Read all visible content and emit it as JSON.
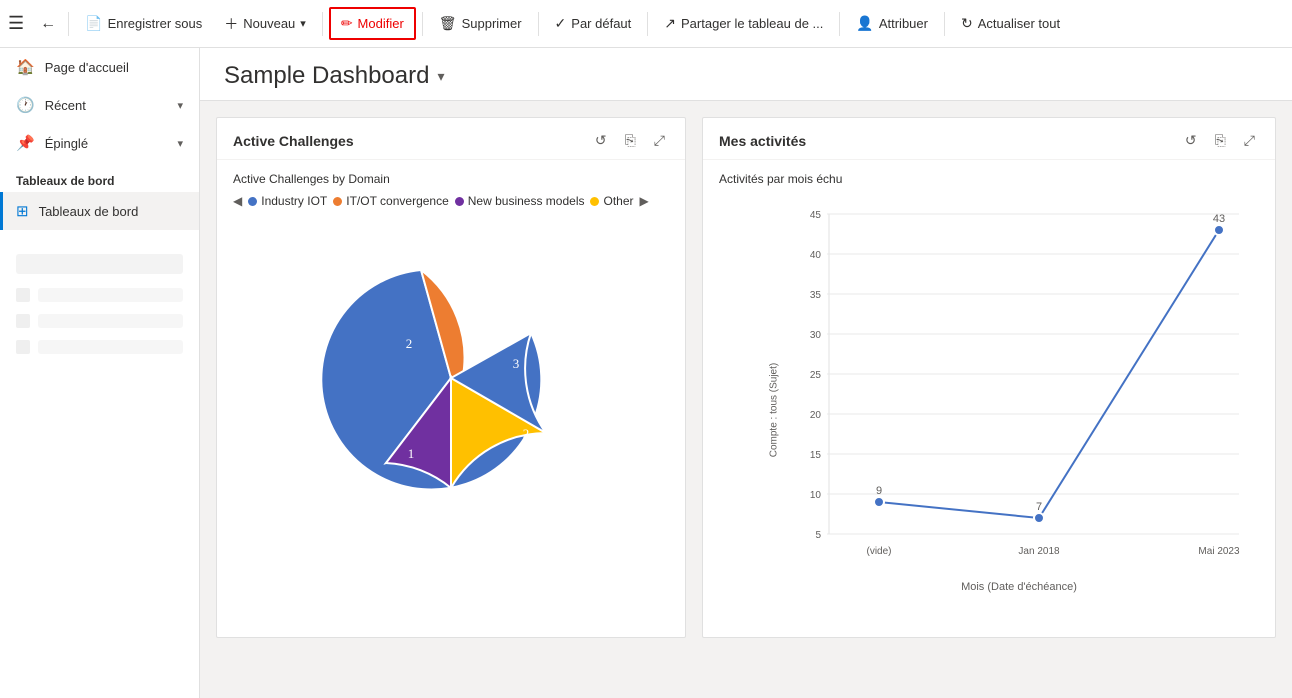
{
  "toolbar": {
    "hamburger_label": "☰",
    "back_label": "←",
    "save_label": "Enregistrer sous",
    "new_label": "Nouveau",
    "new_dropdown": "▾",
    "modifier_label": "Modifier",
    "supprimer_label": "Supprimer",
    "par_defaut_label": "Par défaut",
    "partager_label": "Partager le tableau de ...",
    "attribuer_label": "Attribuer",
    "actualiser_label": "Actualiser tout"
  },
  "sidebar": {
    "items": [
      {
        "icon": "🏠",
        "label": "Page d'accueil",
        "chevron": false
      },
      {
        "icon": "🕐",
        "label": "Récent",
        "chevron": true
      },
      {
        "icon": "📌",
        "label": "Épinglé",
        "chevron": true
      }
    ],
    "section_label": "Tableaux de bord",
    "nav_item": "Tableaux de bord"
  },
  "content": {
    "title": "Sample Dashboard",
    "title_chevron": "▾"
  },
  "active_challenges": {
    "title": "Active Challenges",
    "subtitle": "Active Challenges by Domain",
    "legend": [
      {
        "label": "Industry IOT",
        "color": "#4472C4"
      },
      {
        "label": "IT/OT convergence",
        "color": "#ED7D31"
      },
      {
        "label": "New business models",
        "color": "#7030A0"
      },
      {
        "label": "Other",
        "color": "#FFC000"
      }
    ],
    "pie_segments": [
      {
        "label": "3",
        "color": "#4472C4",
        "startAngle": -10,
        "endAngle": 130,
        "value": 3
      },
      {
        "label": "2",
        "color": "#ED7D31",
        "startAngle": 130,
        "endAngle": 220,
        "value": 2
      },
      {
        "label": "1",
        "color": "#7030A0",
        "startAngle": 220,
        "endAngle": 270,
        "value": 1
      },
      {
        "label": "1",
        "color": "#FFC000",
        "startAngle": 270,
        "endAngle": 330,
        "value": 1
      },
      {
        "label": "2",
        "color": "#4472C4",
        "startAngle": 330,
        "endAngle": 360,
        "value": 2
      }
    ]
  },
  "mes_activites": {
    "title": "Mes activités",
    "subtitle": "Activités par mois échu",
    "y_label": "Compte : tous (Sujet)",
    "x_label": "Mois (Date d'échéance)",
    "y_max": 45,
    "y_ticks": [
      5,
      10,
      15,
      20,
      25,
      30,
      35,
      40,
      45
    ],
    "x_labels": [
      "(vide)",
      "Jan 2018",
      "Mai 2023"
    ],
    "data_points": [
      {
        "x_label": "(vide)",
        "value": 9
      },
      {
        "x_label": "Jan 2018",
        "value": 7
      },
      {
        "x_label": "Mai 2023",
        "value": 43
      }
    ],
    "line_color": "#4472C4"
  },
  "icons": {
    "refresh": "↺",
    "copy": "⎘",
    "expand": "⤢",
    "pencil": "✏",
    "trash": "🗑",
    "check": "✓",
    "share": "↗",
    "person": "👤",
    "cycle": "↻"
  }
}
